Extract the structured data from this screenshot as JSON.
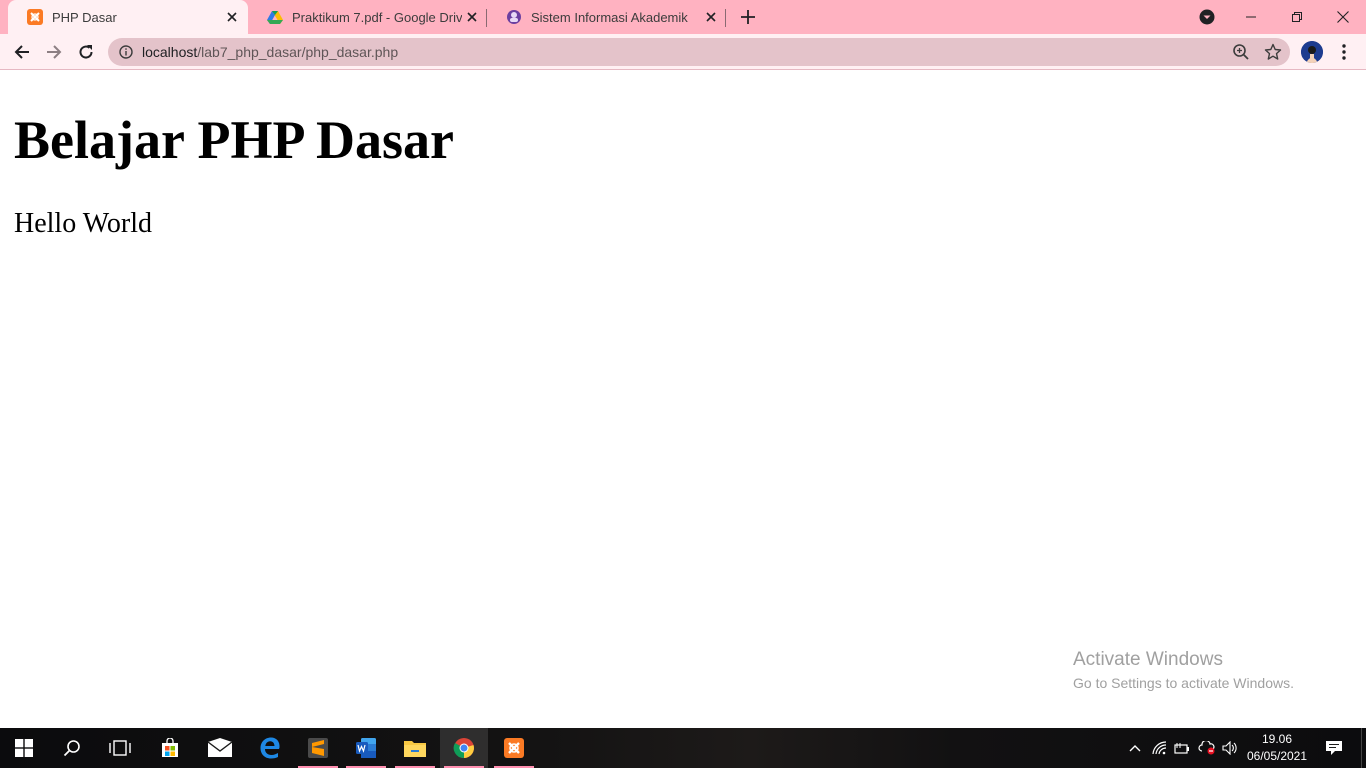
{
  "browser": {
    "tabs": [
      {
        "title": "PHP Dasar",
        "favicon": "xampp-icon",
        "active": true
      },
      {
        "title": "Praktikum 7.pdf - Google Drive",
        "favicon": "google-drive-icon",
        "active": false
      },
      {
        "title": "Sistem Informasi Akademik",
        "favicon": "siakad-icon",
        "active": false
      }
    ],
    "url_host": "localhost",
    "url_path": "/lab7_php_dasar/php_dasar.php",
    "theme_color": "#ffb2c1"
  },
  "page": {
    "heading": "Belajar PHP Dasar",
    "paragraph": "Hello World"
  },
  "watermark": {
    "title": "Activate Windows",
    "subtitle": "Go to Settings to activate Windows."
  },
  "taskbar": {
    "apps": [
      "start-icon",
      "search-icon",
      "task-view-icon",
      "store-icon",
      "mail-icon",
      "edge-icon",
      "sublime-text-icon",
      "word-icon",
      "file-explorer-icon",
      "chrome-icon",
      "xampp-icon"
    ],
    "time": "19.06",
    "date": "06/05/2021"
  }
}
